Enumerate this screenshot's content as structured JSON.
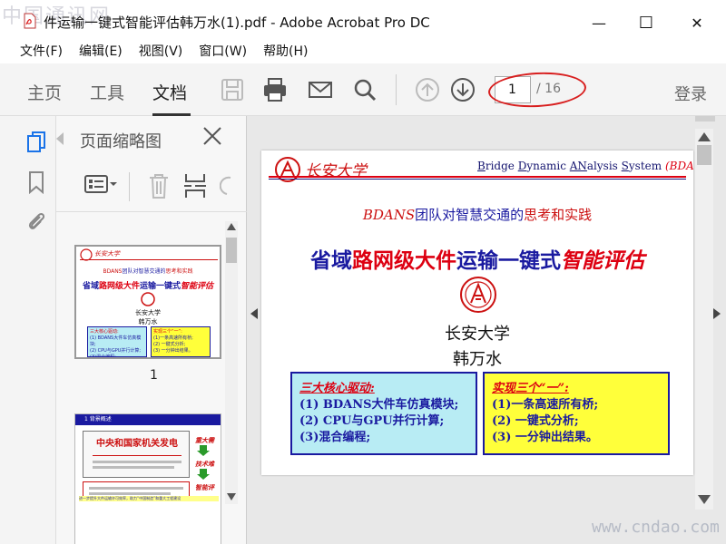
{
  "window": {
    "title": "件运输一键式智能评估韩万水(1).pdf - Adobe Acrobat Pro DC",
    "minimize": "—",
    "maximize": "☐",
    "close": "✕"
  },
  "watermarks": {
    "top_left": "中国通讯网",
    "bottom_right": "www.cndao.com"
  },
  "menu": [
    "文件(F)",
    "编辑(E)",
    "视图(V)",
    "窗口(W)",
    "帮助(H)"
  ],
  "toolbar": {
    "tabs": [
      "主页",
      "工具",
      "文档"
    ],
    "active_tab": "文档",
    "current_page": "1",
    "total_pages": "/ 16",
    "login": "登录"
  },
  "thumbnail_panel": {
    "title": "页面缩略图",
    "page_label": "1"
  },
  "document": {
    "logo_text": "长安大学",
    "header_right": {
      "b": "B",
      "ridge": "ridge ",
      "d": "D",
      "ynamic": "ynamic ",
      "an": "AN",
      "alysis": "alysis ",
      "s": "S",
      "ystem": "ystem ",
      "abbr": "(BDANS)"
    },
    "subtitle": {
      "bdans": "BDANS",
      "team": "团队对智慧交通的",
      "think": "思考和实践"
    },
    "title": {
      "p1": "省域",
      "p2": "路网级大件",
      "p3": "运输一键式",
      "p4": "智能评估"
    },
    "university": "长安大学",
    "author": "韩万水",
    "box_left": {
      "heading": "三大核心驱动:",
      "lines": [
        "(1) BDANS大件车仿真模块;",
        "(2) CPU与GPU并行计算;",
        "(3)混合编程;"
      ]
    },
    "box_right": {
      "heading": "实现三个“一”:",
      "lines": [
        "(1)一条高速所有桥;",
        "(2) 一键式分析;",
        "(3) 一分钟出结果。"
      ]
    }
  },
  "thumbnail_2": {
    "header": "1 背景概述",
    "title": "中央和国家机关发电",
    "side1": "重大需",
    "side2": "技术难",
    "side3": "智能评",
    "footer": "进一步提升大件运输许可效率，助力“中国制造”和重大工程建设"
  },
  "colors": {
    "brand_red": "#d01",
    "navy": "#1a1aa0",
    "cyan_box": "#b8ecf4",
    "yellow_box": "#ffff3a",
    "annotation_red": "#d81e1e"
  }
}
